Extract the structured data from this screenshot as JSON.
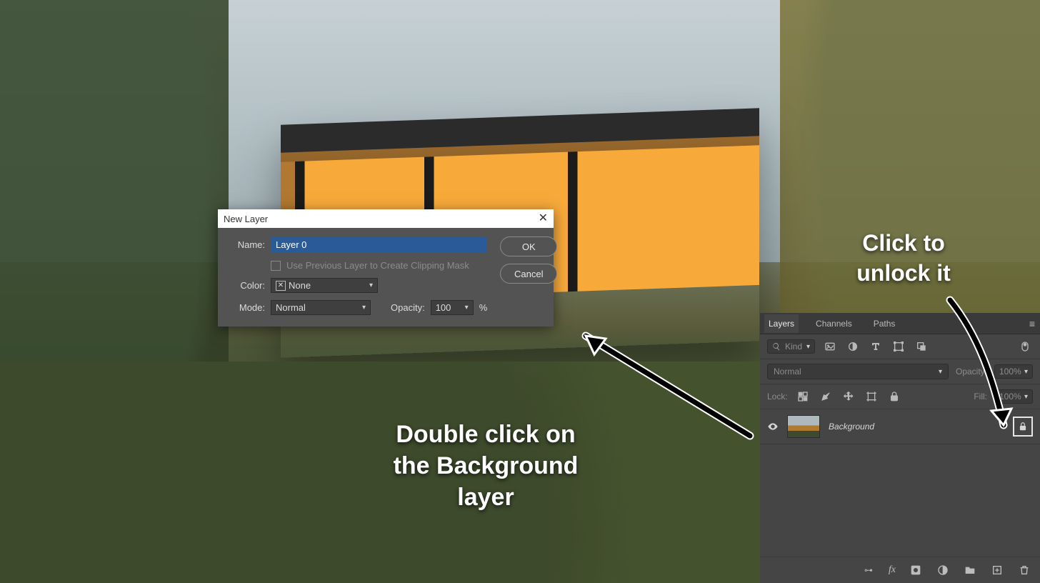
{
  "dialog": {
    "title": "New Layer",
    "close_glyph": "✕",
    "name_label": "Name:",
    "name_value": "Layer 0",
    "clip_label": "Use Previous Layer to Create Clipping Mask",
    "color_label": "Color:",
    "color_value": "None",
    "none_glyph": "✕",
    "mode_label": "Mode:",
    "mode_value": "Normal",
    "opacity_label": "Opacity:",
    "opacity_value": "100",
    "opacity_suffix": "%",
    "ok_label": "OK",
    "cancel_label": "Cancel"
  },
  "layers_panel": {
    "tabs": {
      "layers": "Layers",
      "channels": "Channels",
      "paths": "Paths"
    },
    "menu_glyph": "≡",
    "filter_kind": "Kind",
    "blend_mode": "Normal",
    "opacity_label": "Opacity:",
    "opacity_value": "100%",
    "lock_label": "Lock:",
    "fill_label": "Fill:",
    "fill_value": "100%",
    "layer_name": "Background",
    "footer": {
      "link": "⊶",
      "fx": "fx"
    }
  },
  "annotations": {
    "double_click_l1": "Double click on",
    "double_click_l2": "the Background",
    "double_click_l3": "layer",
    "unlock_l1": "Click to",
    "unlock_l2": "unlock it"
  }
}
